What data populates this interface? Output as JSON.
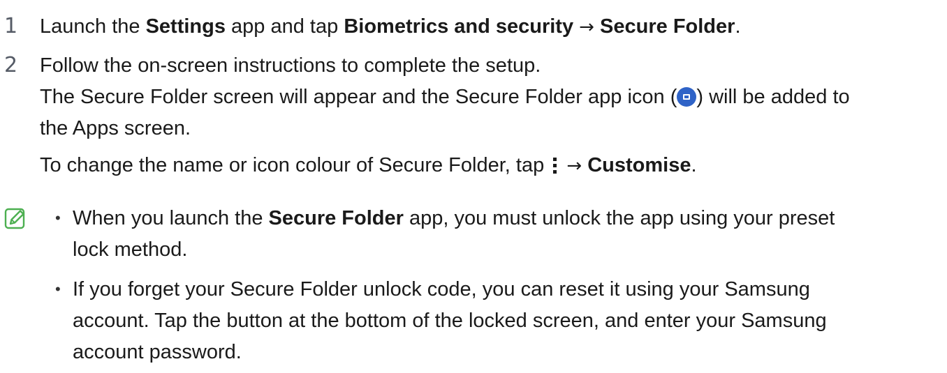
{
  "steps": [
    {
      "number": "1",
      "parts": {
        "a": "Launch the ",
        "b": "Settings",
        "c": " app and tap ",
        "d": "Biometrics and security",
        "e": "→",
        "f": "Secure Folder",
        "g": "."
      }
    },
    {
      "number": "2",
      "line1": "Follow the on-screen instructions to complete the setup.",
      "line2a": "The Secure Folder screen will appear and the Secure Folder app icon (",
      "line2b": ") will be added to",
      "line3": "the Apps screen.",
      "line4a": "To change the name or icon colour of Secure Folder, tap ",
      "line4b": "→",
      "line4c": "Customise",
      "line4d": "."
    }
  ],
  "icons": {
    "app_icon": "secure-folder-app-icon",
    "more_icon": "more-options-icon",
    "note_icon": "note-pencil-icon"
  },
  "notes": [
    {
      "bullet": "•",
      "line1a": "When you launch the ",
      "line1b": "Secure Folder",
      "line1c": " app, you must unlock the app using your preset",
      "line2": "lock method."
    },
    {
      "bullet": "•",
      "line1": "If you forget your Secure Folder unlock code, you can reset it using your Samsung",
      "line2": "account. Tap the button at the bottom of the locked screen, and enter your Samsung",
      "line3": "account password."
    }
  ],
  "colors": {
    "text": "#1a1a1a",
    "step_number": "#555b66",
    "note_icon": "#4caf50",
    "app_icon": "#2f63c7"
  }
}
